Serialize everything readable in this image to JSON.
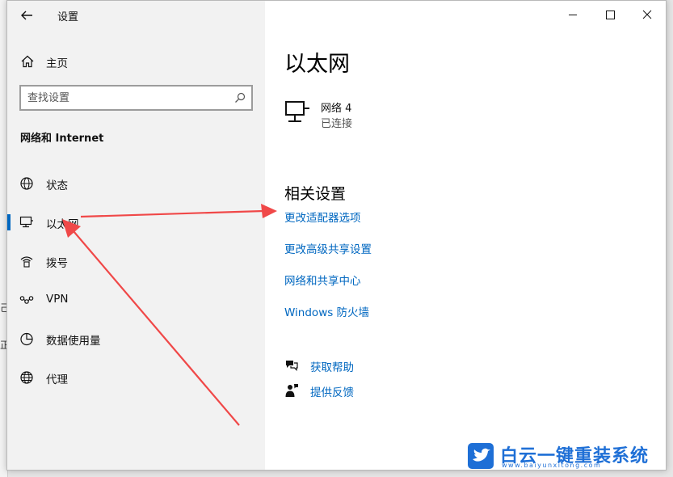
{
  "background": {
    "fragments": [
      "己",
      "正"
    ]
  },
  "window": {
    "app_title": "设置",
    "controls": {
      "minimize": "minimize",
      "maximize": "maximize",
      "close": "close"
    }
  },
  "sidebar": {
    "home_label": "主页",
    "search_placeholder": "查找设置",
    "section_title": "网络和 Internet",
    "items": [
      {
        "label": "状态",
        "icon": "globe-status-icon",
        "selected": false
      },
      {
        "label": "以太网",
        "icon": "ethernet-monitor-icon",
        "selected": true
      },
      {
        "label": "拨号",
        "icon": "dialup-icon",
        "selected": false
      },
      {
        "label": "VPN",
        "icon": "vpn-icon",
        "selected": false
      },
      {
        "label": "数据使用量",
        "icon": "data-usage-icon",
        "selected": false
      },
      {
        "label": "代理",
        "icon": "proxy-globe-icon",
        "selected": false
      }
    ]
  },
  "main": {
    "page_title": "以太网",
    "network": {
      "name": "网络 4",
      "status": "已连接"
    },
    "related_title": "相关设置",
    "links": [
      "更改适配器选项",
      "更改高级共享设置",
      "网络和共享中心",
      "Windows 防火墙"
    ],
    "help": {
      "get_help": "获取帮助",
      "feedback": "提供反馈"
    }
  },
  "watermark": {
    "name": "白云一键重装系统",
    "url": "www.baiyunxitong.com"
  },
  "colors": {
    "accent": "#0067c0",
    "arrow": "#f04848",
    "sidebar_bg": "#f2f2f2",
    "watermark": "#1e6fd6"
  }
}
